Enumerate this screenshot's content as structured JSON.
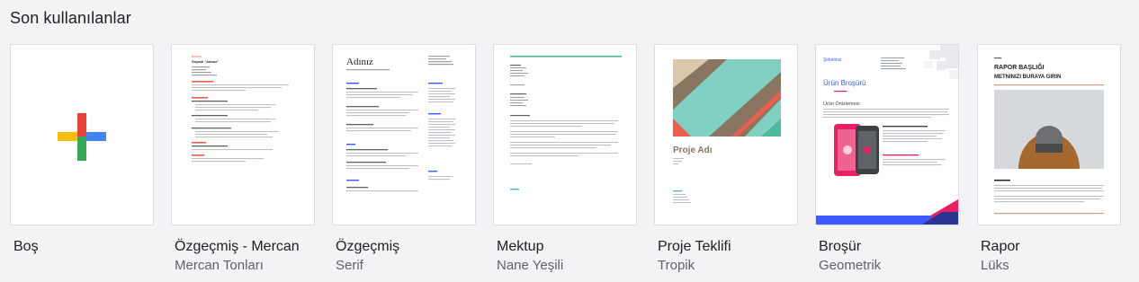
{
  "section": {
    "title": "Son kullanılanlar"
  },
  "templates": [
    {
      "name": "Boş",
      "subtitle": ""
    },
    {
      "name": "Özgeçmiş - Mercan",
      "subtitle": "Mercan Tonları",
      "preview": {
        "line1": "Adınız",
        "line2": "Soyadı \"Adınız\""
      }
    },
    {
      "name": "Özgeçmiş",
      "subtitle": "Serif",
      "preview": {
        "heading": "Adınız"
      }
    },
    {
      "name": "Mektup",
      "subtitle": "Nane Yeşili"
    },
    {
      "name": "Proje Teklifi",
      "subtitle": "Tropik",
      "preview": {
        "heading": "Proje Adı"
      }
    },
    {
      "name": "Broşür",
      "subtitle": "Geometrik",
      "preview": {
        "company": "Şirketiniz",
        "heading": "Ürün Broşürü",
        "subheading": "Ürün Önizlemesi"
      }
    },
    {
      "name": "Rapor",
      "subtitle": "Lüks",
      "preview": {
        "line1": "RAPOR BAŞLIĞI",
        "line2": "METNINIZI BURAYA GIRIN"
      }
    }
  ],
  "colors": {
    "google_blue": "#4285f4",
    "google_red": "#ea4335",
    "google_yellow": "#fbbc04",
    "google_green": "#34a853",
    "coral": "#e8604c",
    "mint": "#4fb99f",
    "teal": "#80d1c4",
    "brochure_blue": "#3d5afe",
    "brochure_pink": "#e91e63"
  }
}
